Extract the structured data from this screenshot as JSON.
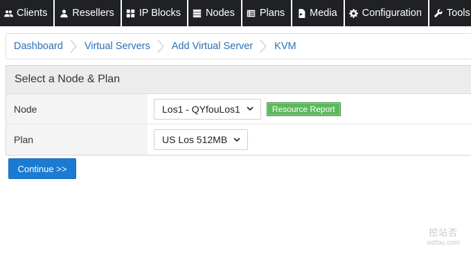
{
  "nav": {
    "items": [
      {
        "label": "Clients",
        "icon": "users-icon"
      },
      {
        "label": "Resellers",
        "icon": "user-icon"
      },
      {
        "label": "IP Blocks",
        "icon": "grid-icon"
      },
      {
        "label": "Nodes",
        "icon": "server-icon"
      },
      {
        "label": "Plans",
        "icon": "list-icon"
      },
      {
        "label": "Media",
        "icon": "file-icon"
      },
      {
        "label": "Configuration",
        "icon": "gear-icon"
      },
      {
        "label": "Tools",
        "icon": "wrench-icon"
      }
    ]
  },
  "breadcrumb": {
    "items": [
      "Dashboard",
      "Virtual Servers",
      "Add Virtual Server",
      "KVM"
    ]
  },
  "panel": {
    "title": "Select a Node & Plan",
    "node_label": "Node",
    "node_value": "Los1 - QYfouLos1",
    "report_button": "Resource Report",
    "plan_label": "Plan",
    "plan_value": "US Los 512MB"
  },
  "continue_button": "Continue >>",
  "watermark": {
    "main": "挖站否",
    "sub": "wzfou.com"
  },
  "colors": {
    "nav_bg": "#1f2124",
    "link": "#2a6fb6",
    "report_button": "#5cb85c",
    "continue_button": "#1b7bd3"
  }
}
